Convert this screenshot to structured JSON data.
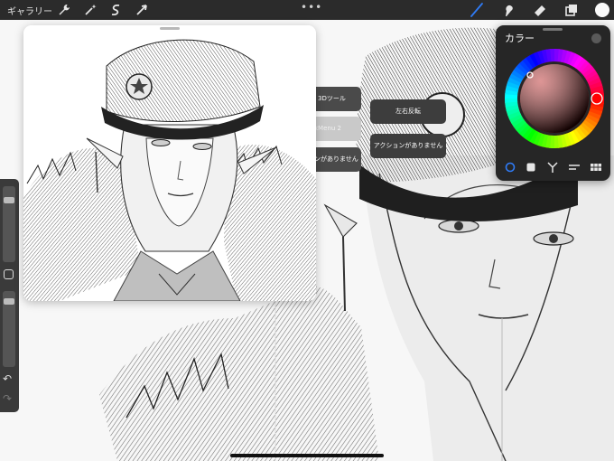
{
  "topbar": {
    "gallery_label": "ギャラリー",
    "left_tools": [
      "wrench-icon",
      "magic-wand-icon",
      "selection-icon",
      "transform-icon"
    ],
    "more_label": "•••",
    "right_tools": [
      "brush-icon",
      "smudge-icon",
      "eraser-icon",
      "layers-icon"
    ],
    "active_tool": "brush-icon",
    "accent_color": "#2f7bf6",
    "current_color": "#fafafa"
  },
  "sidebar": {
    "brush_size": 0.85,
    "opacity": 0.9,
    "undo_icon": "undo-icon",
    "redo_icon": "redo-icon"
  },
  "menus": {
    "back_items": [
      "3Dツール",
      "kMenu 2",
      "ンがありません"
    ],
    "front_items": [
      "左右反転",
      "アクションがありません"
    ]
  },
  "color_panel": {
    "title": "カラー",
    "tabs": [
      "disc-icon",
      "classic-icon",
      "harmony-icon",
      "value-icon",
      "palette-icon"
    ],
    "active_tab": "disc-icon",
    "selected_color": "#b51414"
  }
}
